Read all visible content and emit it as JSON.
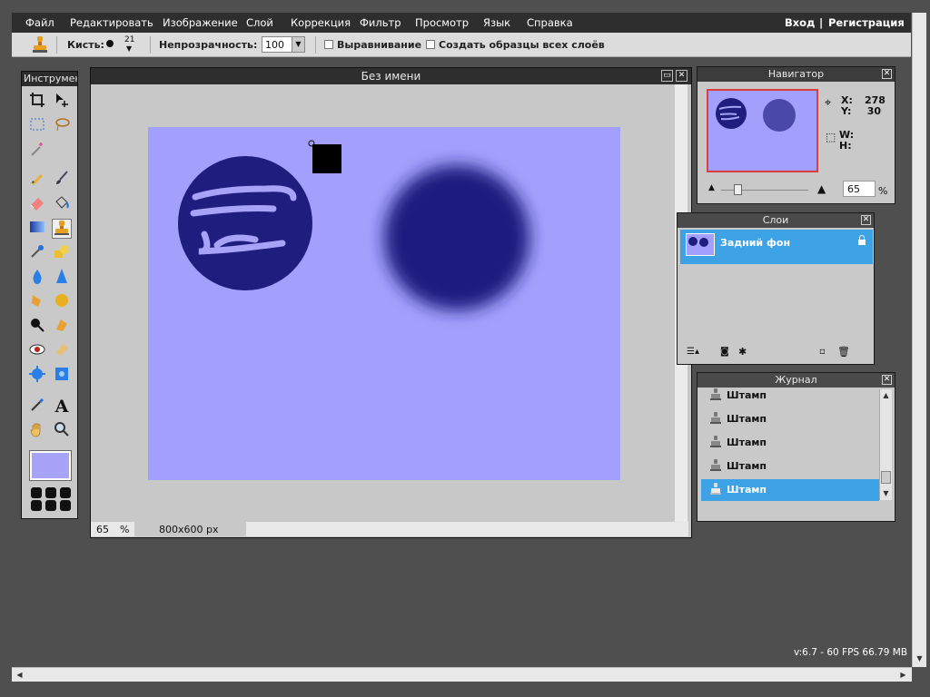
{
  "menubar": {
    "items": [
      "Файл",
      "Редактировать",
      "Изображение",
      "Слой",
      "Коррекция",
      "Фильтр",
      "Просмотр",
      "Язык",
      "Справка"
    ],
    "login": "Вход",
    "separator": "|",
    "register": "Регистрация"
  },
  "toolbar": {
    "brush_label": "Кисть:",
    "brush_size": "21",
    "opacity_label": "Непрозрачность:",
    "opacity_value": "100",
    "align_label": "Выравнивание",
    "sample_all_label": "Создать образцы всех слоёв"
  },
  "tools": {
    "title": "Инструмент",
    "foreground_color": "#a6a3f8",
    "icons": [
      "crop-icon",
      "move-icon",
      "marquee-icon",
      "lasso-icon",
      "wand-icon",
      "pencil-icon",
      "brush-icon",
      "eraser-icon",
      "bucket-icon",
      "gradient-icon",
      "clone-stamp-icon",
      "replace-color-icon",
      "drawing-icon",
      "blur-icon",
      "sharpen-icon",
      "smudge-icon",
      "sponge-icon",
      "dodge-icon",
      "burn-icon",
      "redeye-icon",
      "spot-heal-icon",
      "bloat-icon",
      "pinch-icon",
      "color-picker-icon",
      "type-icon",
      "hand-icon",
      "zoom-icon"
    ]
  },
  "document": {
    "title": "Без имени",
    "zoom": "65",
    "zoom_unit": "%",
    "size": "800x600 px",
    "canvas_color": "#a3a0fd",
    "shape_color": "#1f1e7f"
  },
  "navigator": {
    "title": "Навигатор",
    "x_label": "X:",
    "x_value": "278",
    "y_label": "Y:",
    "y_value": "30",
    "w_label": "W:",
    "h_label": "H:",
    "zoom_value": "65",
    "zoom_unit": "%"
  },
  "layers": {
    "title": "Слои",
    "items": [
      {
        "name": "Задний фон",
        "selected": true
      }
    ]
  },
  "history": {
    "title": "Журнал",
    "items": [
      "Штамп",
      "Штамп",
      "Штамп",
      "Штамп",
      "Штамп"
    ],
    "selected_index": 4
  },
  "footer": {
    "info": "v:6.7 - 60 FPS 66.79 MB"
  },
  "colors": {
    "accent": "#3ea3e6",
    "panel_title": "#3c3c3c",
    "workspace": "#4f4f4f"
  }
}
